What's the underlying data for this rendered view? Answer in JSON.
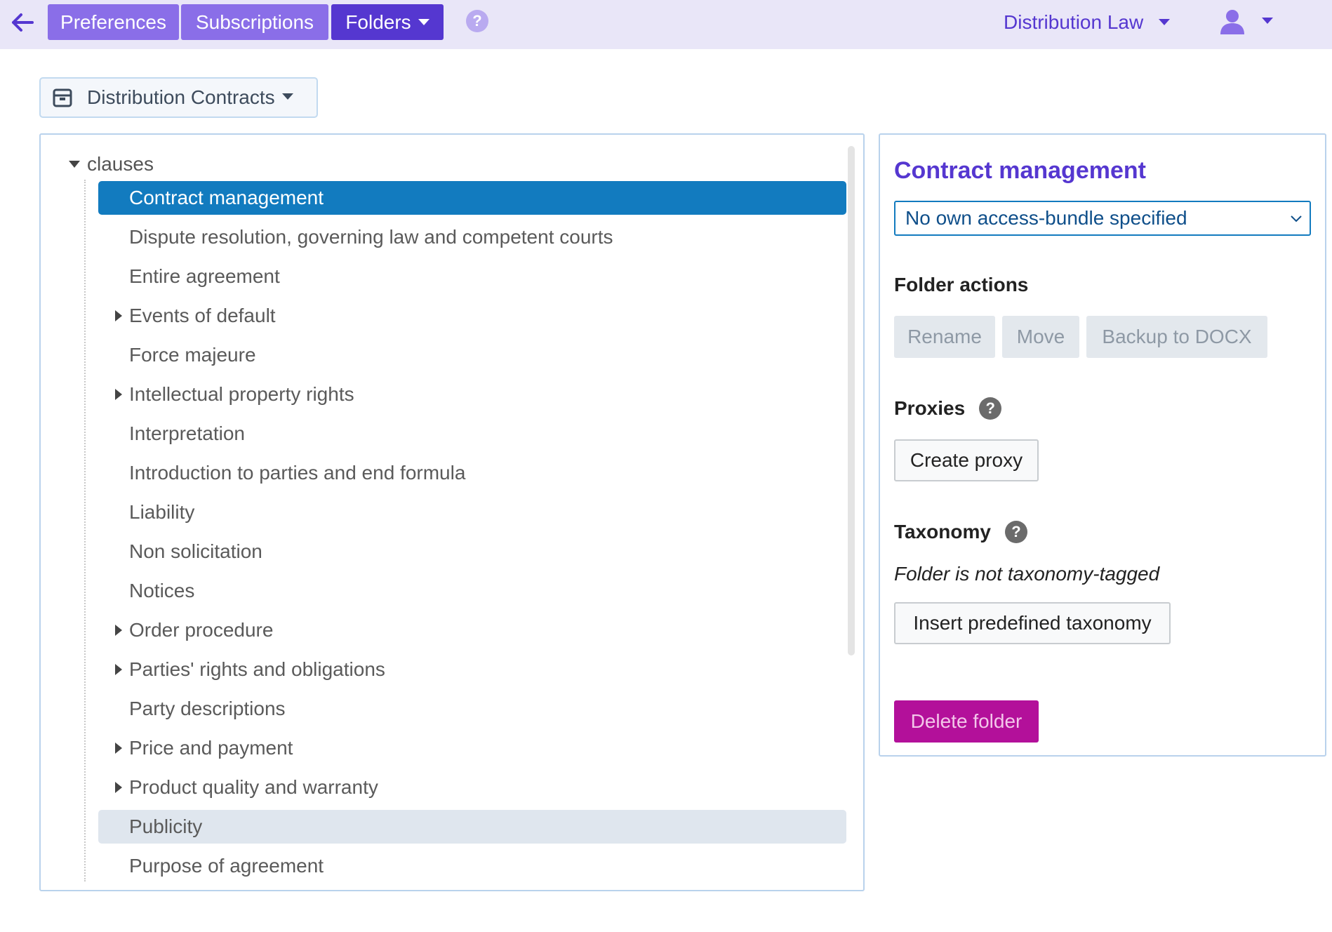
{
  "topbar": {
    "back_icon": "arrow-left-icon",
    "tabs": [
      {
        "label": "Preferences"
      },
      {
        "label": "Subscriptions"
      },
      {
        "label": "Folders"
      }
    ],
    "help_label": "?",
    "workspace": "Distribution Law",
    "user_icon": "user-icon",
    "accent_color": "#5537d0",
    "tab_color": "#8a6ee8"
  },
  "collection": {
    "icon": "archive-box-icon",
    "label": "Distribution Contracts"
  },
  "tree": {
    "root": "clauses",
    "items": [
      {
        "label": "Contract management",
        "expandable": false,
        "state": "selected"
      },
      {
        "label": "Dispute resolution, governing law and competent courts",
        "expandable": false
      },
      {
        "label": "Entire agreement",
        "expandable": false
      },
      {
        "label": "Events of default",
        "expandable": true
      },
      {
        "label": "Force majeure",
        "expandable": false
      },
      {
        "label": "Intellectual property rights",
        "expandable": true
      },
      {
        "label": "Interpretation",
        "expandable": false
      },
      {
        "label": "Introduction to parties and end formula",
        "expandable": false
      },
      {
        "label": "Liability",
        "expandable": false
      },
      {
        "label": "Non solicitation",
        "expandable": false
      },
      {
        "label": "Notices",
        "expandable": false
      },
      {
        "label": "Order procedure",
        "expandable": true
      },
      {
        "label": "Parties' rights and obligations",
        "expandable": true
      },
      {
        "label": "Party descriptions",
        "expandable": false
      },
      {
        "label": "Price and payment",
        "expandable": true
      },
      {
        "label": "Product quality and warranty",
        "expandable": true
      },
      {
        "label": "Publicity",
        "expandable": false,
        "state": "hover"
      },
      {
        "label": "Purpose of agreement",
        "expandable": false
      }
    ],
    "selected_color": "#127bbf"
  },
  "side": {
    "title": "Contract management",
    "access_bundle": "No own access-bundle specified",
    "folder_actions": {
      "heading": "Folder actions",
      "rename": "Rename",
      "move": "Move",
      "backup": "Backup to DOCX"
    },
    "proxies": {
      "heading": "Proxies",
      "help": "?",
      "create": "Create proxy"
    },
    "taxonomy": {
      "heading": "Taxonomy",
      "help": "?",
      "status": "Folder is not taxonomy-tagged",
      "insert": "Insert predefined taxonomy"
    },
    "delete": "Delete folder",
    "delete_color": "#b3109a"
  }
}
